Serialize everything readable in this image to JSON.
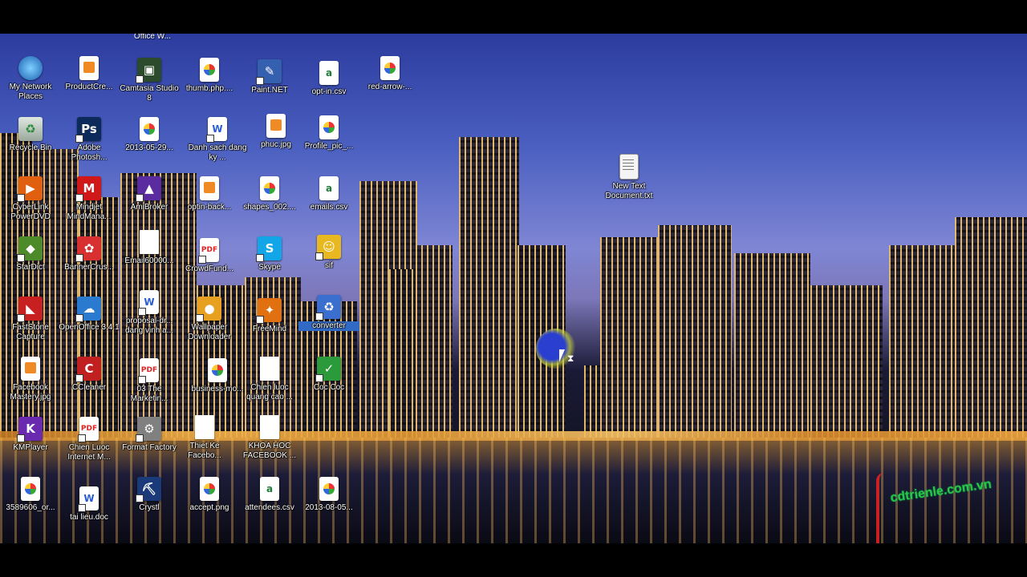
{
  "desktop": {
    "cut_top_label": "Office W...",
    "icons": [
      {
        "label": "My Network Places",
        "type": "net"
      },
      {
        "label": "ProductCre...",
        "type": "jpg"
      },
      {
        "label": "Camtasia Studio 8",
        "type": "app",
        "glyph": "▣",
        "color": "#2c4b2c"
      },
      {
        "label": "thumb.php....",
        "type": "png"
      },
      {
        "label": "Paint.NET",
        "type": "app",
        "glyph": "✎",
        "color": "#3560b0"
      },
      {
        "label": "opt-in.csv",
        "type": "excel"
      },
      {
        "label": "red-arrow-...",
        "type": "png"
      },
      {
        "label": "Recycle Bin",
        "type": "recycle"
      },
      {
        "label": "Adobe Photosh...",
        "type": "app",
        "glyph": "Ps",
        "color": "#0c2a5a"
      },
      {
        "label": "2013-05-29...",
        "type": "png"
      },
      {
        "label": "Danh sach dang ky ...",
        "type": "word"
      },
      {
        "label": "phuc.jpg",
        "type": "jpg"
      },
      {
        "label": "Profile_pic_...",
        "type": "png"
      },
      {
        "label": "New Text Document.txt",
        "type": "txt"
      },
      {
        "label": "CyberLink PowerDVD",
        "type": "app",
        "glyph": "▶",
        "color": "#e06010"
      },
      {
        "label": "Mindjet MindMana...",
        "type": "app",
        "glyph": "M",
        "color": "#d01818"
      },
      {
        "label": "AmiBroker",
        "type": "app",
        "glyph": "▲",
        "color": "#5a2ca0"
      },
      {
        "label": "optin-back...",
        "type": "jpg"
      },
      {
        "label": "shapes_002....",
        "type": "png"
      },
      {
        "label": "emails.csv",
        "type": "excel"
      },
      {
        "label": "StarDict",
        "type": "app",
        "glyph": "◆",
        "color": "#4d8a2a"
      },
      {
        "label": "BannerCrus...",
        "type": "app",
        "glyph": "✿",
        "color": "#d83030"
      },
      {
        "label": "Email60000...",
        "type": "doc"
      },
      {
        "label": "CrowdFund...",
        "type": "pdf"
      },
      {
        "label": "Skype",
        "type": "app",
        "glyph": "S",
        "color": "#12a5e8"
      },
      {
        "label": "sif",
        "type": "app",
        "glyph": "☺",
        "color": "#e8b820"
      },
      {
        "label": "FastStone Capture",
        "type": "app",
        "glyph": "◣",
        "color": "#c82020"
      },
      {
        "label": "OpenOffice 3.4.1",
        "type": "app",
        "glyph": "☁",
        "color": "#2a7ad0"
      },
      {
        "label": "proposal-dr... dang vinh a...",
        "type": "word"
      },
      {
        "label": "Wallpaper Downloader",
        "type": "app",
        "glyph": "●",
        "color": "#e8a020"
      },
      {
        "label": "FreeMind",
        "type": "app",
        "glyph": "✦",
        "color": "#e07010"
      },
      {
        "label": "converter",
        "type": "app",
        "glyph": "♻",
        "color": "#3a6fd0"
      },
      {
        "label": "Facebook Mastery.jpg",
        "type": "jpg"
      },
      {
        "label": "CCleaner",
        "type": "app",
        "glyph": "C",
        "color": "#c02020"
      },
      {
        "label": "03 The Marketin...",
        "type": "pdf"
      },
      {
        "label": "business-mo...",
        "type": "png"
      },
      {
        "label": "Chien luoc quang cao ...",
        "type": "doc"
      },
      {
        "label": "Coc Coc",
        "type": "app",
        "glyph": "✓",
        "color": "#2a9a3a"
      },
      {
        "label": "KMPlayer",
        "type": "app",
        "glyph": "K",
        "color": "#6a2ab0"
      },
      {
        "label": "Chien Luoc Internet M...",
        "type": "pdf"
      },
      {
        "label": "Format Factory",
        "type": "app",
        "glyph": "⚙",
        "color": "#808080"
      },
      {
        "label": "Thiet Ke Facebo...",
        "type": "doc"
      },
      {
        "label": "KHOA HOC FACEBOOK ...",
        "type": "doc"
      },
      {
        "label": "3589606_or...",
        "type": "png"
      },
      {
        "label": "tai lieu.doc",
        "type": "word"
      },
      {
        "label": "Crystl",
        "type": "app",
        "glyph": "⛏",
        "color": "#1a3a7a"
      },
      {
        "label": "accept.png",
        "type": "png"
      },
      {
        "label": "attendees.csv",
        "type": "excel"
      },
      {
        "label": "2013-08-05...",
        "type": "png"
      }
    ],
    "watermark": "cdtrienle.com.vn"
  }
}
